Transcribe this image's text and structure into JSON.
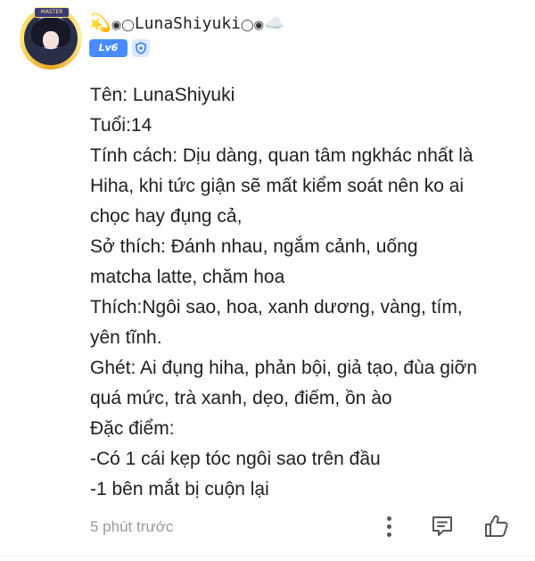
{
  "comment": {
    "author": {
      "name": "LunaShiyuki",
      "name_prefix": "◉◯",
      "name_suffix": "◯◉",
      "level": "Lv6",
      "avatar_badge": "MASTER"
    },
    "body_lines": [
      "Tên: LunaShiyuki",
      "Tuổi:14",
      "Tính cách: Dịu dàng, quan tâm ngkhác nhất là",
      "Hiha, khi tức giận sẽ mất kiểm soát nên ko ai",
      "chọc hay đụng cả,",
      "Sở thích: Đánh nhau, ngắm cảnh, uống",
      "matcha latte, chăm hoa",
      "Thích:Ngôi sao, hoa, xanh dương, vàng, tím,",
      "yên tĩnh.",
      "Ghét: Ai đụng hiha, phản bội, giả tạo, đùa giỡn",
      "quá mức, trà xanh, dẹo, điếm, ồn ào",
      "Đặc điểm:",
      "-Có 1 cái kẹp tóc ngôi sao trên đầu",
      "-1 bên mắt bị cuộn lại"
    ],
    "timestamp": "5 phút trước"
  },
  "icons": {
    "prefix_emoji": "dizzy-icon",
    "suffix_emoji": "cloud-icon",
    "verify": "shield-icon",
    "more": "more-vertical-icon",
    "reply": "comment-icon",
    "like": "thumbs-up-icon"
  },
  "colors": {
    "level_badge": "#4a8cff",
    "timestamp": "#9a9a9a",
    "icon_gray": "#555555"
  }
}
